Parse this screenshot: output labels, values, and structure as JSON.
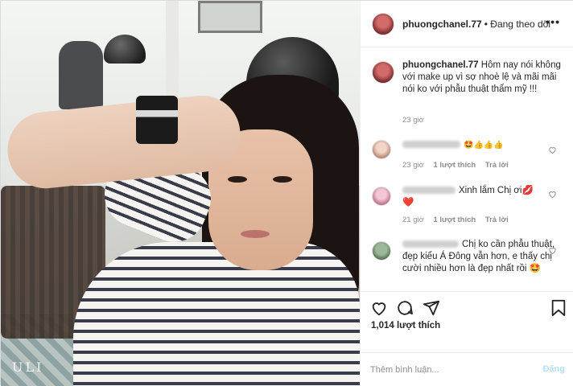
{
  "post": {
    "username": "phuongchanel.77",
    "follow_status": "Đang theo dõi",
    "more_label": "•••",
    "watermark": "ULI"
  },
  "caption": {
    "username": "phuongchanel.77",
    "text": "Hôm nay nói không với make up vì sợ nhoè lệ và mãi mãi nói ko với phẫu thuật thẩm mỹ !!!",
    "time": "23 giờ"
  },
  "comments": [
    {
      "text": "🤩👍👍👍",
      "time": "23 giờ",
      "likes": "1 lượt thích",
      "reply": "Trả lời"
    },
    {
      "text": "Xinh lắm Chị ơi💋 ❤️",
      "time": "21 giờ",
      "likes": "1 lượt thích",
      "reply": "Trả lời"
    },
    {
      "text": "Chị ko cần phẫu thuật, đẹp kiểu Á Đông vẫn hơn, e thấy chị cười nhiều hơn là đẹp nhất rồi 🤩"
    }
  ],
  "stats": {
    "likes": "1,014 lượt thích"
  },
  "add_comment": {
    "placeholder": "Thêm bình luận...",
    "post_label": "Đăng"
  },
  "icons": {
    "like": "heart-icon",
    "comment": "comment-icon",
    "share": "share-icon",
    "save": "bookmark-icon",
    "more": "more-icon"
  },
  "colors": {
    "link": "#b2dffc",
    "muted": "#8e8e8e",
    "text": "#262626"
  }
}
